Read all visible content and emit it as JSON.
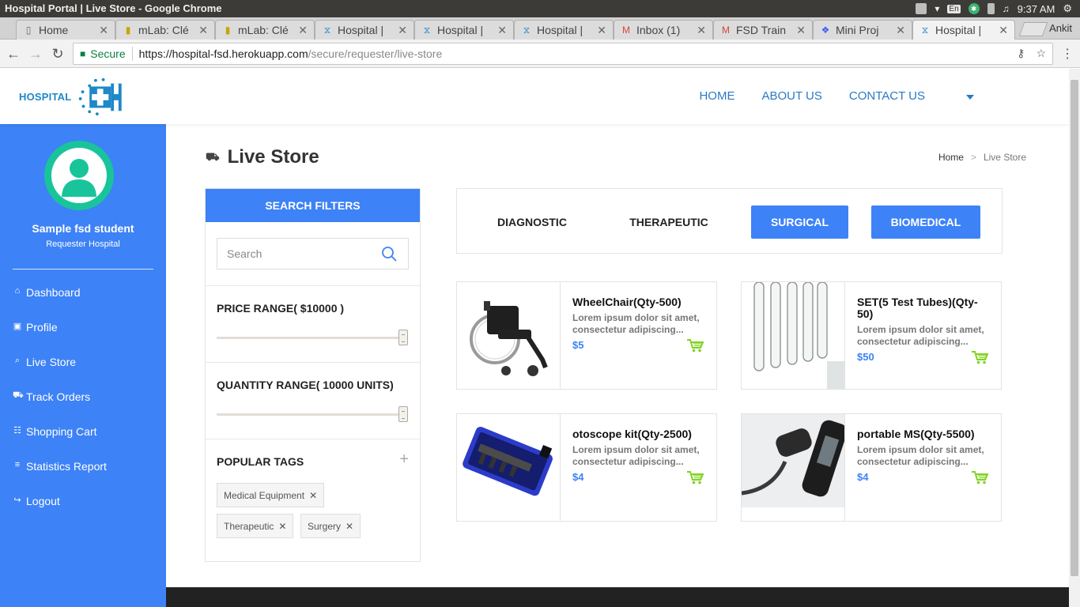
{
  "os": {
    "window_title": "Hospital Portal | Live Store - Google Chrome",
    "clock": "9:37 AM",
    "lang": "En"
  },
  "browser": {
    "tabs": [
      {
        "label": "Home",
        "icon": "page-icon",
        "active": false
      },
      {
        "label": "mLab: Clé",
        "icon": "mlab-icon",
        "active": false
      },
      {
        "label": "mLab: Clé",
        "icon": "mlab-icon",
        "active": false
      },
      {
        "label": "Hospital |",
        "icon": "hospital-icon",
        "active": false
      },
      {
        "label": "Hospital |",
        "icon": "hospital-icon",
        "active": false
      },
      {
        "label": "Hospital |",
        "icon": "hospital-icon",
        "active": false
      },
      {
        "label": "Inbox (1)",
        "icon": "gmail-icon",
        "active": false
      },
      {
        "label": "FSD Train",
        "icon": "gmail-icon",
        "active": false
      },
      {
        "label": "Mini Proj",
        "icon": "dropbox-icon",
        "active": false
      },
      {
        "label": "Hospital |",
        "icon": "hospital-icon",
        "active": true
      }
    ],
    "profile": "Ankit",
    "secure_label": "Secure",
    "url_host": "https://hospital-fsd.herokuapp.com",
    "url_path": "/secure/requester/live-store"
  },
  "header": {
    "logo_text": "HOSPITAL",
    "nav": [
      "HOME",
      "ABOUT US",
      "CONTACT US"
    ]
  },
  "sidebar": {
    "user_name": "Sample fsd student",
    "user_role": "Requester Hospital",
    "items": [
      {
        "label": "Dashboard",
        "icon": "home-icon",
        "glyph": "⌂"
      },
      {
        "label": "Profile",
        "icon": "profile-icon",
        "glyph": "▣"
      },
      {
        "label": "Live Store",
        "icon": "search-icon",
        "glyph": "⌕"
      },
      {
        "label": "Track Orders",
        "icon": "truck-icon",
        "glyph": "⛟"
      },
      {
        "label": "Shopping Cart",
        "icon": "cart-icon",
        "glyph": "☷"
      },
      {
        "label": "Statistics Report",
        "icon": "report-icon",
        "glyph": "≡"
      },
      {
        "label": "Logout",
        "icon": "logout-icon",
        "glyph": "↪"
      }
    ]
  },
  "main": {
    "title": "Live Store",
    "breadcrumb": {
      "home": "Home",
      "sep": ">",
      "current": "Live Store"
    },
    "filters": {
      "heading": "SEARCH FILTERS",
      "search_placeholder": "Search",
      "price_label": "PRICE RANGE( $10000 )",
      "price_level": 1.0,
      "quantity_label": "QUANTITY RANGE( 10000 UNITS)",
      "quantity_level": 1.0,
      "tags_label": "POPULAR TAGS",
      "tags": [
        "Medical Equipment",
        "Therapeutic",
        "Surgery"
      ]
    },
    "categories": [
      {
        "label": "DIAGNOSTIC",
        "style": "plain"
      },
      {
        "label": "THERAPEUTIC",
        "style": "plain"
      },
      {
        "label": "SURGICAL",
        "style": "button"
      },
      {
        "label": "BIOMEDICAL",
        "style": "button"
      }
    ],
    "products": [
      {
        "name": "WheelChair(Qty-500)",
        "desc": "Lorem ipsum dolor sit amet, consectetur adipiscing...",
        "price": "$5",
        "image": "wheelchair"
      },
      {
        "name": "SET(5 Test Tubes)(Qty-50)",
        "desc": "Lorem ipsum dolor sit amet, consectetur adipiscing...",
        "price": "$50",
        "image": "test-tubes"
      },
      {
        "name": "otoscope kit(Qty-2500)",
        "desc": "Lorem ipsum dolor sit amet, consectetur adipiscing...",
        "price": "$4",
        "image": "otoscope-kit"
      },
      {
        "name": "portable MS(Qty-5500)",
        "desc": "Lorem ipsum dolor sit amet, consectetur adipiscing...",
        "price": "$4",
        "image": "portable-ms"
      }
    ]
  },
  "colors": {
    "accent": "#3d82f6",
    "avatar": "#19c49b",
    "cart": "#7ed321",
    "nav_link": "#2a79c4"
  }
}
